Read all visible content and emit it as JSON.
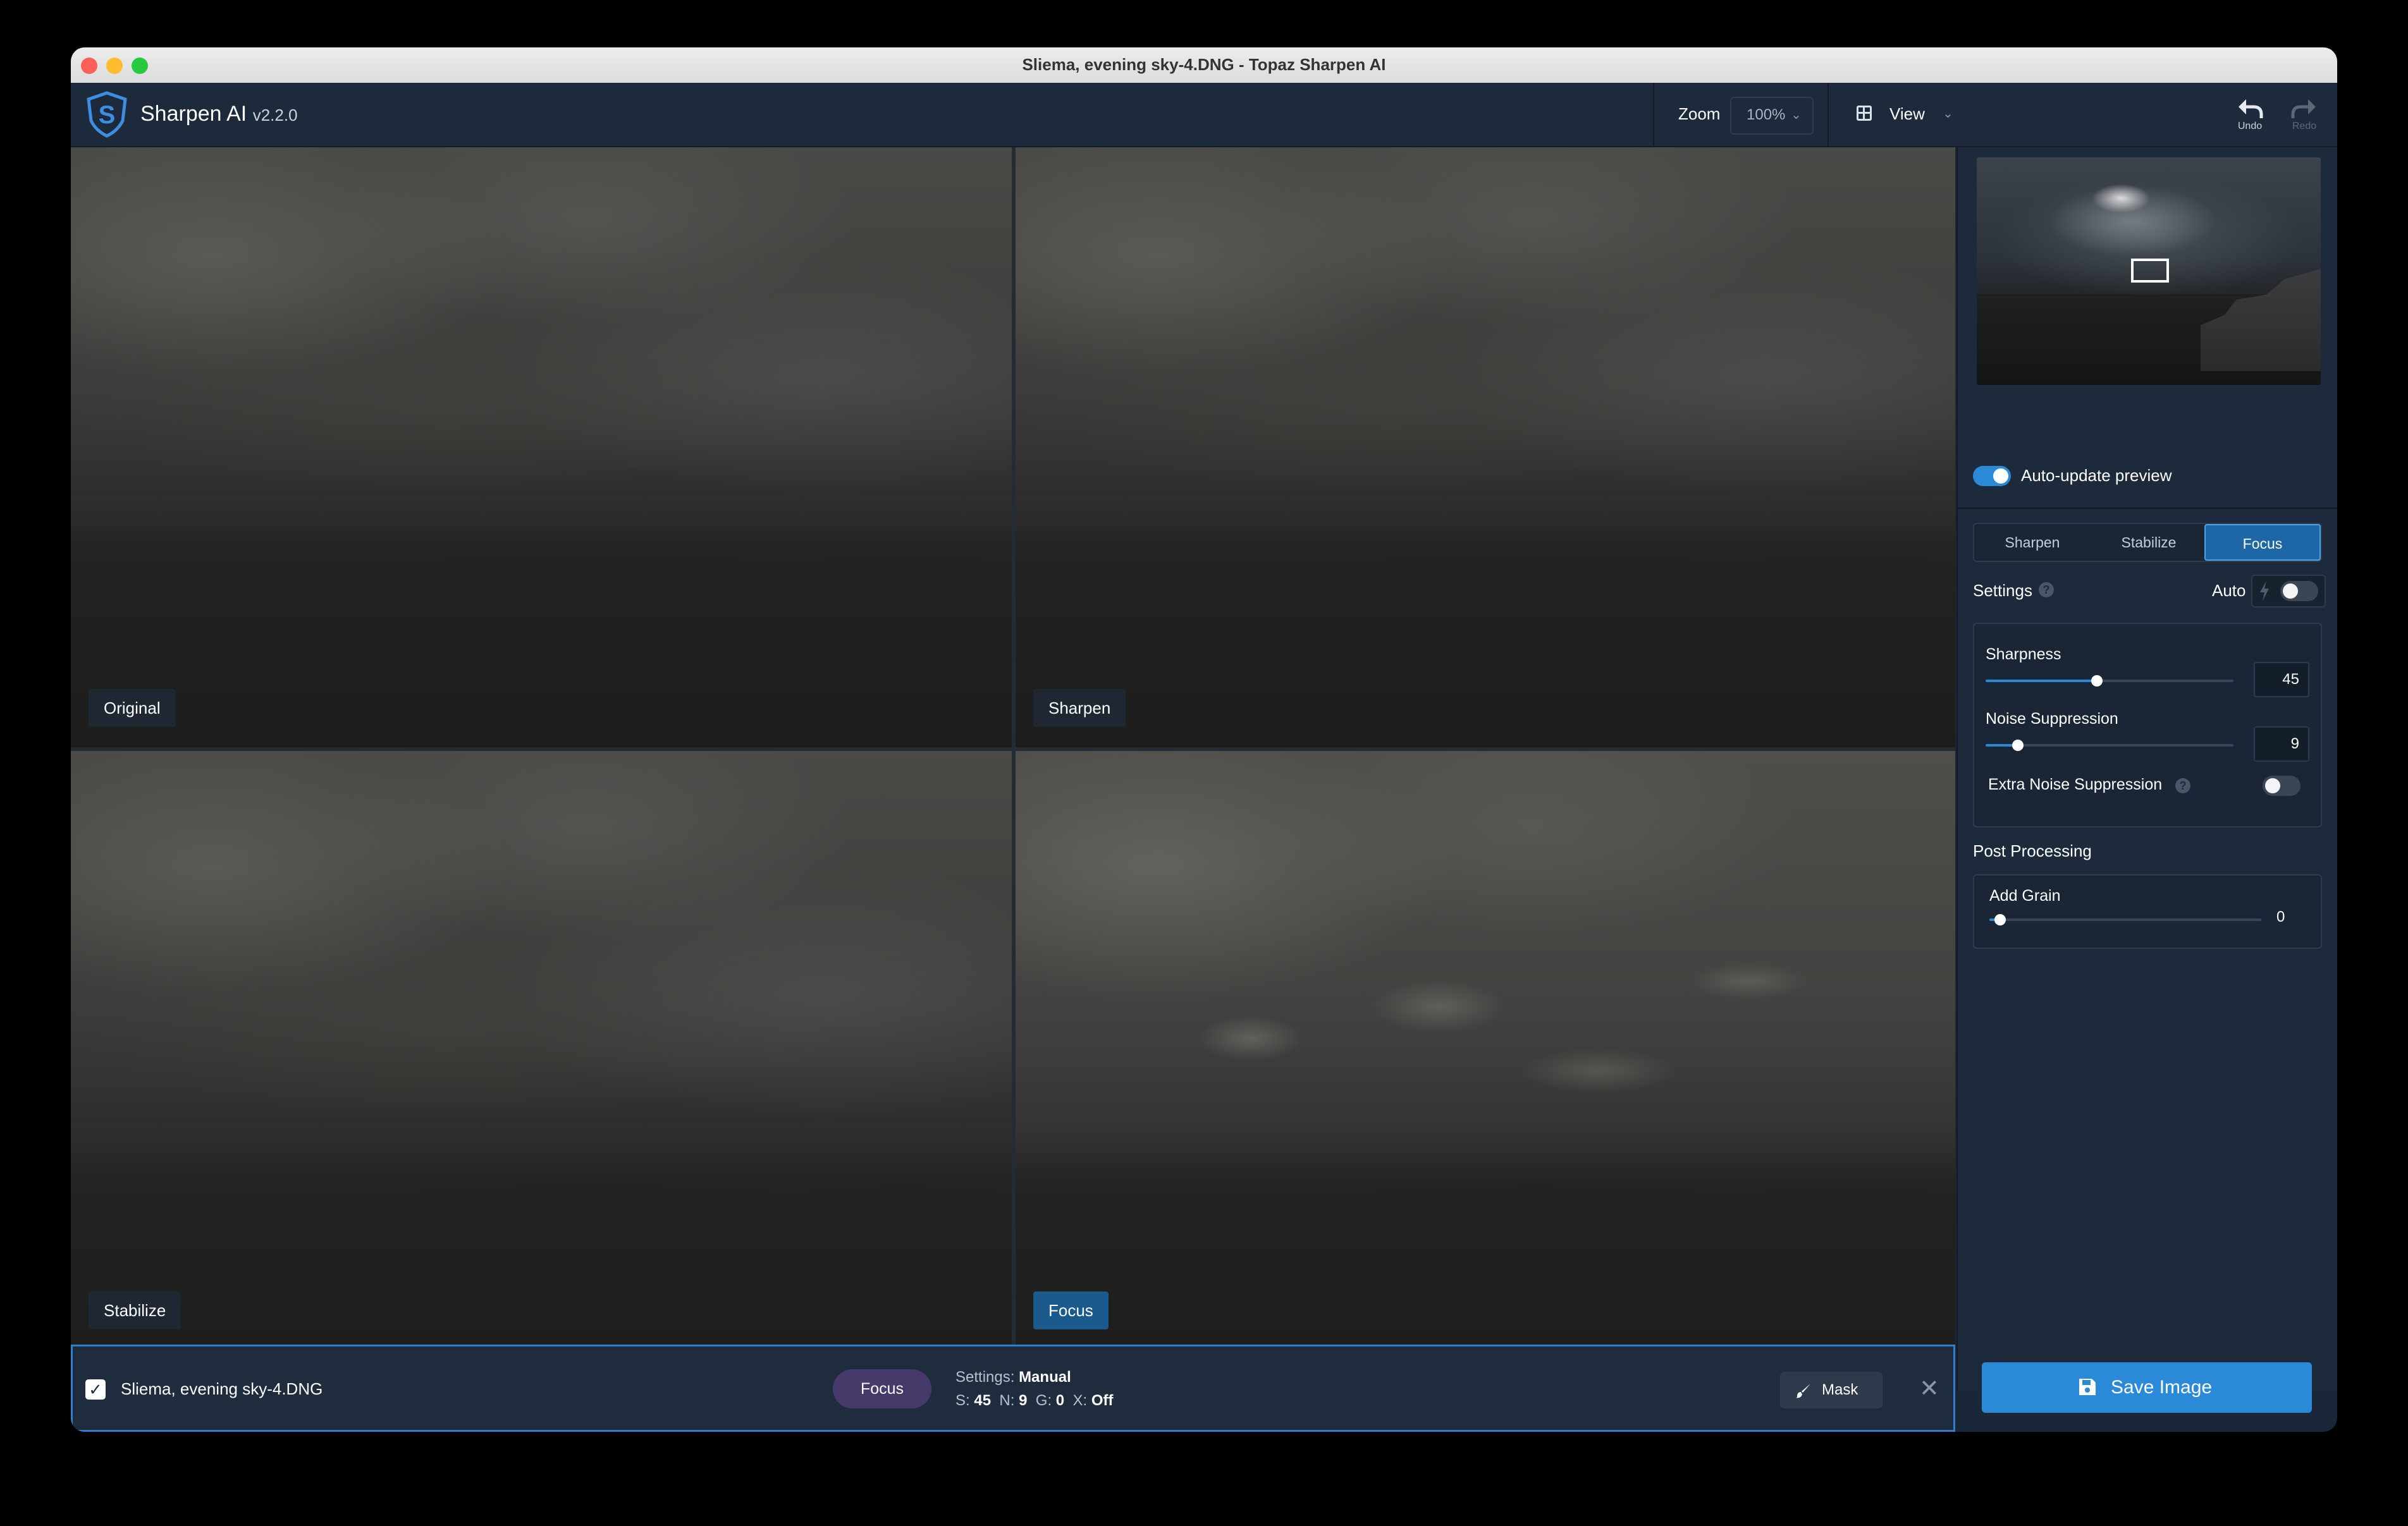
{
  "window": {
    "title": "Sliema, evening sky-4.DNG - Topaz Sharpen AI"
  },
  "header": {
    "app_name": "Sharpen AI",
    "version": "v2.2.0",
    "zoom_label": "Zoom",
    "zoom_value": "100%",
    "view_label": "View",
    "undo_label": "Undo",
    "redo_label": "Redo"
  },
  "panes": [
    {
      "label": "Original"
    },
    {
      "label": "Sharpen"
    },
    {
      "label": "Stabilize"
    },
    {
      "label": "Focus"
    }
  ],
  "sidebar": {
    "auto_update_label": "Auto-update preview",
    "auto_update_on": true,
    "modes": [
      "Sharpen",
      "Stabilize",
      "Focus"
    ],
    "active_mode": "Focus",
    "settings_label": "Settings",
    "auto_label": "Auto",
    "auto_on": false,
    "sliders": [
      {
        "label": "Sharpness",
        "value": "45",
        "fraction": 0.45
      },
      {
        "label": "Noise Suppression",
        "value": "9",
        "fraction": 0.13
      }
    ],
    "extra_noise_label": "Extra Noise Suppression",
    "extra_noise_on": false,
    "post_processing_label": "Post Processing",
    "add_grain_label": "Add Grain",
    "add_grain_value": "0",
    "add_grain_fraction": 0.04
  },
  "filebar": {
    "file_name": "Sliema, evening sky-4.DNG",
    "checked": true,
    "mode_pill": "Focus",
    "settings_prefix": "Settings:",
    "settings_value": "Manual",
    "s_label": "S:",
    "s_value": "45",
    "n_label": "N:",
    "n_value": "9",
    "g_label": "G:",
    "g_value": "0",
    "x_label": "X:",
    "x_value": "Off",
    "mask_label": "Mask",
    "close_glyph": "✕"
  },
  "save_button": "Save Image",
  "colors": {
    "accent": "#2a8ad8",
    "pill": "#463a6b",
    "panel": "#1c2a3b"
  }
}
